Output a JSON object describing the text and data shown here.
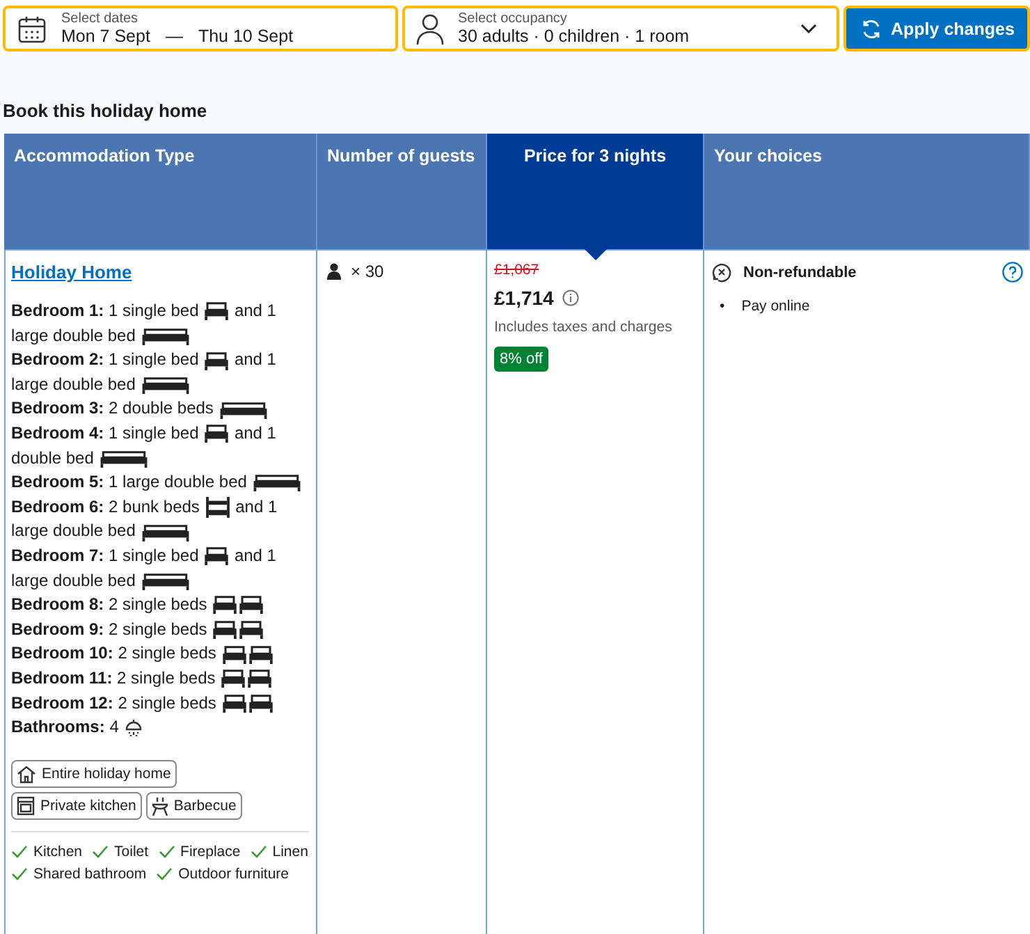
{
  "search_bar": {
    "dates": {
      "label": "Select dates",
      "check_in": "Mon 7 Sept",
      "separator": "—",
      "check_out": "Thu 10 Sept"
    },
    "occupancy": {
      "label": "Select occupancy",
      "value": "30 adults · 0 children · 1 room"
    },
    "button": "Apply changes"
  },
  "heading": "Book this holiday home",
  "table": {
    "columns": [
      {
        "label": "Accommodation Type",
        "selected": false
      },
      {
        "label": "Number of guests",
        "selected": false
      },
      {
        "label": "Price for 3 nights",
        "selected": true
      },
      {
        "label": "Your choices",
        "selected": false
      }
    ],
    "row": {
      "unit_name": "Holiday Home",
      "rooms": [
        {
          "label": "Bedroom 1:",
          "parts": [
            {
              "text": "1 single bed",
              "icons": [
                {
                  "kind": "single"
                }
              ]
            },
            {
              "text": "and 1"
            },
            {
              "text": "large double bed",
              "icons": [
                {
                  "kind": "double"
                }
              ]
            }
          ]
        },
        {
          "label": "Bedroom 2:",
          "parts": [
            {
              "text": "1 single bed",
              "icons": [
                {
                  "kind": "single"
                }
              ]
            },
            {
              "text": "and 1"
            },
            {
              "text": "large double bed",
              "icons": [
                {
                  "kind": "double"
                }
              ]
            }
          ]
        },
        {
          "label": "Bedroom 3:",
          "parts": [
            {
              "text": "2 double beds",
              "icons": [
                {
                  "kind": "double"
                }
              ]
            }
          ]
        },
        {
          "label": "Bedroom 4:",
          "parts": [
            {
              "text": "1 single bed",
              "icons": [
                {
                  "kind": "single"
                }
              ]
            },
            {
              "text": "and 1"
            },
            {
              "text": "double bed",
              "icons": [
                {
                  "kind": "double"
                }
              ]
            }
          ]
        },
        {
          "label": "Bedroom 5:",
          "parts": [
            {
              "text": "1 large double bed",
              "icons": [
                {
                  "kind": "double"
                }
              ]
            }
          ]
        },
        {
          "label": "Bedroom 6:",
          "parts": [
            {
              "text": "2 bunk beds",
              "icons": [
                {
                  "kind": "bunk"
                }
              ]
            },
            {
              "text": "and 1"
            },
            {
              "text": "large double bed",
              "icons": [
                {
                  "kind": "double"
                }
              ]
            }
          ]
        },
        {
          "label": "Bedroom 7:",
          "parts": [
            {
              "text": "1 single bed",
              "icons": [
                {
                  "kind": "single"
                }
              ]
            },
            {
              "text": "and 1"
            },
            {
              "text": "large double bed",
              "icons": [
                {
                  "kind": "double"
                }
              ]
            }
          ]
        },
        {
          "label": "Bedroom 8:",
          "parts": [
            {
              "text": "2 single beds",
              "icons": [
                {
                  "kind": "single"
                },
                {
                  "kind": "single"
                }
              ]
            }
          ]
        },
        {
          "label": "Bedroom 9:",
          "parts": [
            {
              "text": "2 single beds",
              "icons": [
                {
                  "kind": "single"
                },
                {
                  "kind": "single"
                }
              ]
            }
          ]
        },
        {
          "label": "Bedroom 10:",
          "parts": [
            {
              "text": "2 single beds",
              "icons": [
                {
                  "kind": "single"
                },
                {
                  "kind": "single"
                }
              ]
            }
          ]
        },
        {
          "label": "Bedroom 11:",
          "parts": [
            {
              "text": "2 single beds",
              "icons": [
                {
                  "kind": "single"
                },
                {
                  "kind": "single"
                }
              ]
            }
          ]
        },
        {
          "label": "Bedroom 12:",
          "parts": [
            {
              "text": "2 single beds",
              "icons": [
                {
                  "kind": "single"
                },
                {
                  "kind": "single"
                }
              ]
            }
          ]
        },
        {
          "label": "Bathrooms:",
          "parts": [
            {
              "text": "4",
              "icons": [
                {
                  "kind": "shower"
                }
              ]
            }
          ]
        }
      ],
      "facilities": [
        {
          "kind": "house",
          "label": "Entire holiday home"
        },
        {
          "kind": "kitchen",
          "label": "Private kitchen"
        },
        {
          "kind": "barbecue",
          "label": "Barbecue"
        }
      ],
      "amenities": [
        "Kitchen",
        "Toilet",
        "Fireplace",
        "Linen",
        "Shared bathroom",
        "Outdoor furniture"
      ],
      "guests": "× 30",
      "old_price": "£1,067",
      "price": "£1,714",
      "price_note": "Includes taxes and charges",
      "discount": "8% off",
      "policy": "Non-refundable",
      "conditions": [
        {
          "marker": "•",
          "text": "Pay online"
        }
      ]
    }
  }
}
